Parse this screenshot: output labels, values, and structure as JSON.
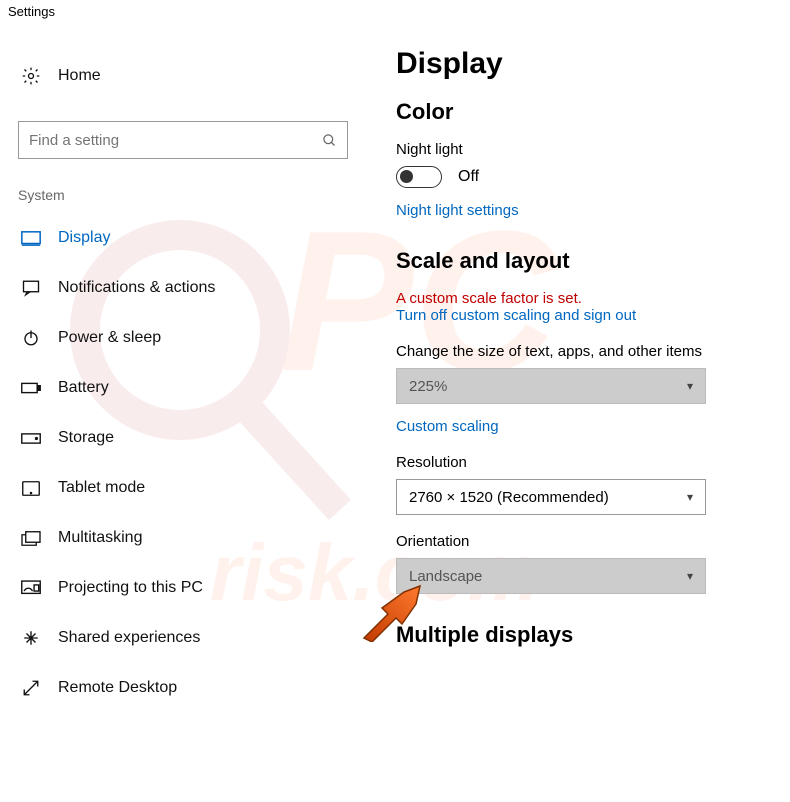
{
  "window_title": "Settings",
  "home_label": "Home",
  "search": {
    "placeholder": "Find a setting"
  },
  "category": "System",
  "nav": [
    {
      "name": "display",
      "label": "Display",
      "active": true
    },
    {
      "name": "notifications",
      "label": "Notifications & actions"
    },
    {
      "name": "power",
      "label": "Power & sleep"
    },
    {
      "name": "battery",
      "label": "Battery"
    },
    {
      "name": "storage",
      "label": "Storage"
    },
    {
      "name": "tablet",
      "label": "Tablet mode"
    },
    {
      "name": "multitasking",
      "label": "Multitasking"
    },
    {
      "name": "projecting",
      "label": "Projecting to this PC"
    },
    {
      "name": "shared",
      "label": "Shared experiences"
    },
    {
      "name": "remote",
      "label": "Remote Desktop"
    }
  ],
  "main": {
    "title": "Display",
    "color_section": "Color",
    "night_light_label": "Night light",
    "night_light_state": "Off",
    "night_light_link": "Night light settings",
    "scale_section": "Scale and layout",
    "custom_scale_warning": "A custom scale factor is set.",
    "turn_off_scaling_link": "Turn off custom scaling and sign out",
    "size_label": "Change the size of text, apps, and other items",
    "size_value": "225%",
    "custom_scaling_link": "Custom scaling",
    "resolution_label": "Resolution",
    "resolution_value": "2760 × 1520 (Recommended)",
    "orientation_label": "Orientation",
    "orientation_value": "Landscape",
    "multiple_displays_section": "Multiple displays"
  }
}
